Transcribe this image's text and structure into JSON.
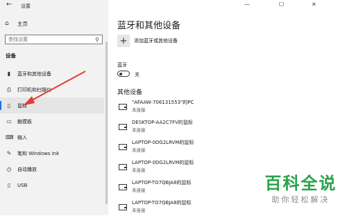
{
  "window": {
    "title": "设置",
    "back_icon": "back-arrow-icon",
    "minimize": "—",
    "maximize": "☐",
    "close": "✕"
  },
  "sidebar": {
    "home": {
      "label": "主页",
      "icon": "home-icon"
    },
    "search": {
      "placeholder": "查找设置"
    },
    "section_title": "设备",
    "items": [
      {
        "label": "蓝牙和其他设备",
        "icon": "bluetooth-devices-icon"
      },
      {
        "label": "打印机和扫描仪",
        "icon": "printer-icon"
      },
      {
        "label": "鼠标",
        "icon": "mouse-icon",
        "active": true
      },
      {
        "label": "触摸板",
        "icon": "touchpad-icon"
      },
      {
        "label": "输入",
        "icon": "keyboard-icon"
      },
      {
        "label": "笔和 Windows Ink",
        "icon": "pen-icon"
      },
      {
        "label": "自动播放",
        "icon": "autoplay-icon"
      },
      {
        "label": "USB",
        "icon": "usb-icon"
      }
    ]
  },
  "main": {
    "title": "蓝牙和其他设备",
    "add_device": "添加蓝牙或其他设备",
    "bluetooth": {
      "label": "蓝牙",
      "state": "关"
    },
    "other_devices_title": "其他设备",
    "devices": [
      {
        "name": "\"AFAAW-706131553\"的PC",
        "status": "未连接"
      },
      {
        "name": "DESKTOP-AA2C7FV的鼠标",
        "status": "未连接"
      },
      {
        "name": "LAPTOP-0DG2LRVM的鼠标",
        "status": "未连接"
      },
      {
        "name": "LAPTOP-0DG2LRVM的鼠标",
        "status": "未连接"
      },
      {
        "name": "LAPTOP-TO7QBJA8的鼠标",
        "status": "未连接"
      },
      {
        "name": "LAPTOP-TO7QBJA8的鼠标",
        "status": "未连接"
      }
    ]
  },
  "watermark": {
    "title": "百科全说",
    "subtitle": "助你轻松解决"
  },
  "colors": {
    "accent": "#1a73e8",
    "arrow": "#e53935",
    "watermark": "#2aa24a"
  }
}
